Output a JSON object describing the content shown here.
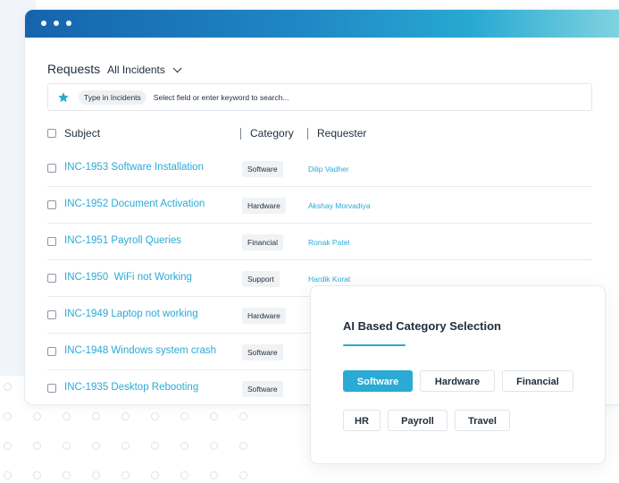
{
  "header": {
    "title": "Requests",
    "filter_label": "All Incidents"
  },
  "search": {
    "chip": "Type in Incidents",
    "placeholder": "Select field or enter keyword to search..."
  },
  "columns": {
    "subject": "Subject",
    "category": "Category",
    "requester": "Requester"
  },
  "rows": [
    {
      "subject": "INC-1953 Software Installation",
      "category": "Software",
      "requester": "Dilip Vadher"
    },
    {
      "subject": "INC-1952 Document Activation",
      "category": "Hardware",
      "requester": "Akshay Morvadiya"
    },
    {
      "subject": "INC-1951 Payroll Queries",
      "category": "Financial",
      "requester": "Ronak Patel"
    },
    {
      "subject": "INC-1950  WiFi not Working",
      "category": "Support",
      "requester": "Hardik Korat"
    },
    {
      "subject": "INC-1949 Laptop not working",
      "category": "Hardware",
      "requester": ""
    },
    {
      "subject": "INC-1948 Windows system crash",
      "category": "Software",
      "requester": ""
    },
    {
      "subject": "INC-1935 Desktop Rebooting",
      "category": "Software",
      "requester": ""
    }
  ],
  "ai_panel": {
    "title": "AI Based Category Selection",
    "options": [
      "Software",
      "Hardware",
      "Financial",
      "HR",
      "Payroll",
      "Travel"
    ],
    "selected": "Software"
  },
  "colors": {
    "accent": "#2aaad5",
    "titlebar_start": "#1564ad",
    "titlebar_end": "#7fd3df"
  },
  "icons": [
    "star-icon",
    "chevron-down-icon"
  ]
}
